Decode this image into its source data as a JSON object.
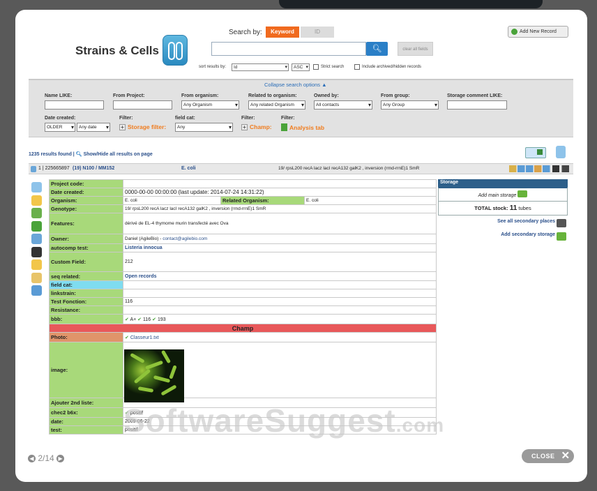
{
  "app": {
    "title": "Strains & Cells"
  },
  "search": {
    "label": "Search by:",
    "tab_keyword": "Keyword",
    "tab_id": "ID",
    "query_value": "",
    "clear_label": "clear all fields",
    "add_label": "Add New Record",
    "sort_label": "sort results by:",
    "sort_field": "Id",
    "sort_order": "ASC",
    "strict_label": "Strict search",
    "include_label": "Include archived/hidden records"
  },
  "filters": {
    "collapse_label": "Collapse search options ▲",
    "name_like": "Name LIKE:",
    "from_project": "From Project:",
    "from_organism": "From organism:",
    "from_organism_value": "Any Organism",
    "related_organism": "Related to organism:",
    "related_organism_value": "Any related Organism",
    "owned_by": "Owned by:",
    "owned_by_value": "All contacts",
    "from_group": "From group:",
    "from_group_value": "Any Group",
    "storage_comment": "Storage comment LIKE:",
    "date_created": "Date created:",
    "date_older": "OLDER",
    "date_any": "Any date",
    "filter1": "Filter:",
    "storage_filter": "Storage filter:",
    "field_cat": "field cat:",
    "field_cat_value": "Any",
    "filter2": "Filter:",
    "champ": "Champ:",
    "filter3": "Filter:",
    "analysis_tab": "Analysis tab"
  },
  "results": {
    "count": "1235 results found |",
    "toggle": "Show/Hide all results on page"
  },
  "record": {
    "index": "1 | 225665897",
    "name": "(19) N100 / MM152",
    "organism": "E. coli",
    "genotype": "19/ rpsL200 recA lacz lacI recA132 galK2 , inversion (rrnd-rrnE)1 SmR"
  },
  "fields": [
    {
      "label": "Project code:",
      "value": ""
    },
    {
      "label": "Date created:",
      "value": "0000-00-00 00:00:00 (last update: 2014-07-24 14:31:22)"
    },
    {
      "label": "Organism:",
      "value": "E. coli",
      "extra_label": "Related Organism:",
      "extra_value": "E. coli"
    },
    {
      "label": "Genotype:",
      "value": "19/ rpsL200 recA lacz lacI recA132 galK2 , inversion (rrnd-rrnE)1 SmR"
    },
    {
      "label": "Features:",
      "value": "dérivé de EL-4 thymome murin transfecté avec Ova"
    },
    {
      "label": "Owner:",
      "value": "Daniel (AgileBio) - ",
      "link": "contact@agilebio.com"
    },
    {
      "label": "autocomp test:",
      "value": "Listeria innocua"
    },
    {
      "label": "Custom Field:",
      "value": "212"
    },
    {
      "label": "seq related:",
      "value": "Open records"
    },
    {
      "label": "field cat:",
      "value": ""
    },
    {
      "label": "linkstrain:",
      "value": ""
    },
    {
      "label": "Test Fonction:",
      "value": "116"
    },
    {
      "label": "Resistance:",
      "value": ""
    },
    {
      "label": "bbb:",
      "value": "A+",
      "value2": "116",
      "value3": "193"
    },
    {
      "label": "Champ"
    },
    {
      "label": "Photo:",
      "value": "Classeur1.txt"
    },
    {
      "label": "image:",
      "value": ""
    },
    {
      "label": "Ajouter 2nd liste:",
      "value": ""
    },
    {
      "label": "chec2 b6x:",
      "value": "positif"
    },
    {
      "label": "date:",
      "value": "2009-06-22"
    },
    {
      "label": "test:",
      "value": "positif"
    }
  ],
  "storage": {
    "head": "Storage",
    "add_main": "Add main storage",
    "total_label": "TOTAL stock:",
    "total_count": "11",
    "total_unit": "tubes",
    "see_all": "See all secondary places",
    "add_secondary": "Add secondary storage"
  },
  "watermark": {
    "main": "SoftwareSuggest",
    "suffix": ".com"
  },
  "viewer": {
    "page": "2/14",
    "close": "CLOSE"
  }
}
